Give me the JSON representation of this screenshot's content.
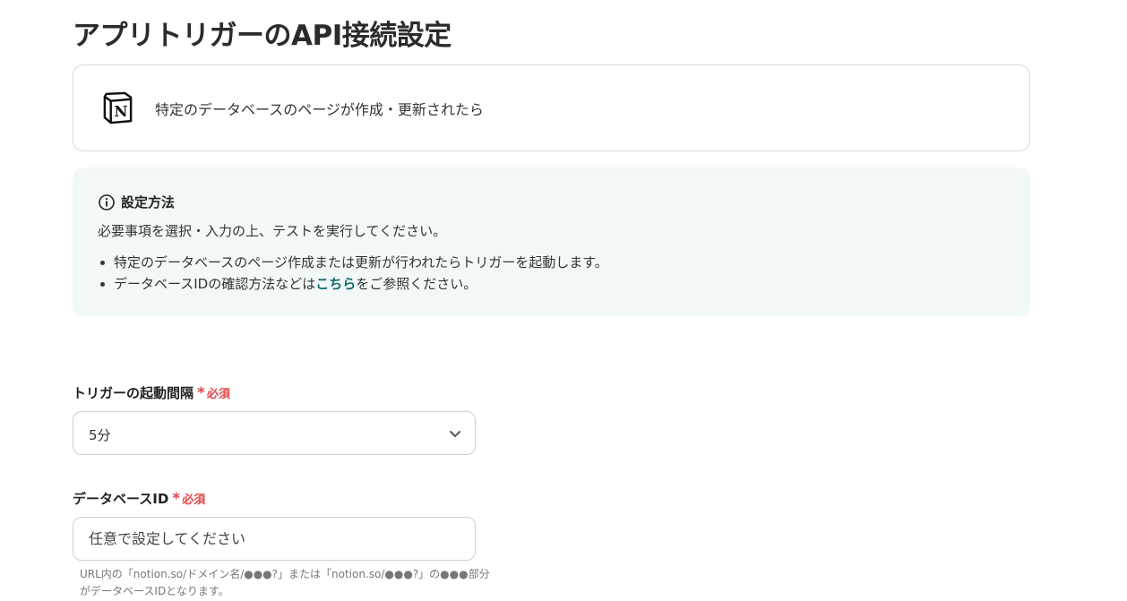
{
  "page": {
    "title": "アプリトリガーのAPI接続設定"
  },
  "app_card": {
    "logo_icon": "notion-logo-icon",
    "trigger_text": "特定のデータベースのページが作成・更新されたら"
  },
  "help": {
    "icon": "info-icon",
    "title": "設定方法",
    "intro": "必要事項を選択・入力の上、テストを実行してください。",
    "items": [
      {
        "text": "特定のデータベースのページ作成または更新が行われたらトリガーを起動します。"
      },
      {
        "before": "データベースIDの確認方法などは",
        "link": "こちら",
        "after": "をご参照ください。"
      }
    ],
    "link_color": "#0e6b6b",
    "background": "#f1f8f7"
  },
  "fields": {
    "interval": {
      "label": "トリガーの起動間隔",
      "required_mark": "*",
      "required_text": "必須",
      "value": "5分",
      "icon": "chevron-down-icon"
    },
    "database_id": {
      "label": "データベースID",
      "required_mark": "*",
      "required_text": "必須",
      "value": "",
      "placeholder": "任意で設定してください",
      "hint": "URL内の「notion.so/ドメイン名/●●●?」または「notion.so/●●●?」の●●●部分がデータベースIDとなります。"
    }
  },
  "colors": {
    "required": "#e0464b",
    "border": "#cfcfcf"
  }
}
